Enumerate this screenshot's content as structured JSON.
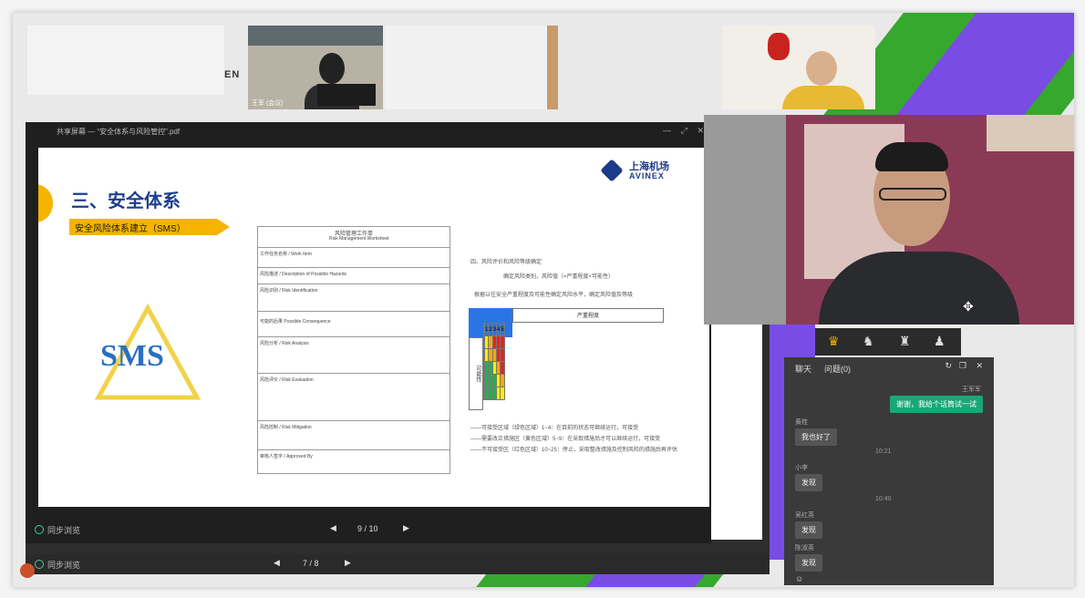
{
  "meeting": {
    "participant_name_tag": "王军 (会议)",
    "brand_fragment": "EN"
  },
  "shared_window": {
    "title": "共享屏幕 — “安全体系与风险管控”.pdf",
    "window_controls": [
      "—",
      "⤢",
      "✕"
    ]
  },
  "slide": {
    "logo_cn": "上海机场",
    "logo_en": "AVINEX",
    "heading": "三、安全体系",
    "subheading": "安全风险体系建立（SMS）",
    "sms_label": "SMS",
    "doc_title": "风险管理工作单",
    "doc_subtitle": "Risk Management Worksheet",
    "doc_right_intro": "四、风险评价和风险等级确定",
    "doc_right_line1": "确定风险类别，风险值（=严重程度×可能性）",
    "doc_right_line2": "根据以往安全严重程度及可能性确定风险水平，确定风险值及等级",
    "matrix_header": "严重程度",
    "matrix_side": "可能性",
    "matrix_levels": [
      "1",
      "2",
      "3",
      "4",
      "5"
    ],
    "notes": [
      "——可接受区域（绿色区域）1~4：在目前的状态可继续运行，可接受",
      "——需要改正措施区（黄色区域）5~9：在采取措施后才可以继续运行，可接受",
      "——不可接受区（红色区域）10~25：停止，采取整改措施及控制风险的措施后再评估"
    ],
    "form_rows": [
      "工作任务名称 / Work Item",
      "风险描述 / Description of Possible Hazards",
      "风险识别 / Risk Identification",
      "可能的后果 Possible Consequence",
      "风险分析 / Risk Analysis",
      "风险评价 / Risk Evaluation",
      "风险控制 / Risk Mitigation",
      "审核人签字 / Approved By"
    ]
  },
  "front_controls": {
    "sync_label": "同步浏览",
    "page_indicator": "9 / 10"
  },
  "back_controls": {
    "sync_label": "同步浏览",
    "page_indicator": "7 / 8"
  },
  "chat": {
    "tabs": [
      "聊天",
      "问题(0)"
    ],
    "outgoing": {
      "sender": "王军军",
      "text": "谢谢，我给个话筒试一试"
    },
    "messages": [
      {
        "sender": "黄桂",
        "text": "我也好了"
      },
      {
        "time": "10:21"
      },
      {
        "sender": "小李",
        "text": "发现"
      },
      {
        "time": "10:40"
      },
      {
        "sender": "吴红英",
        "text": "发现"
      },
      {
        "sender": "陈淑英",
        "text": "发现"
      }
    ]
  },
  "toolbar": {
    "icons": [
      "crown-icon",
      "speaker-icon",
      "trophy-icon",
      "person-icon"
    ]
  },
  "colors": {
    "green": "#22b24c",
    "purple": "#7a4ce6",
    "accent_yellow": "#f6b300",
    "matrix_blue": "#2a75e6",
    "chat_green": "#1aa777"
  }
}
